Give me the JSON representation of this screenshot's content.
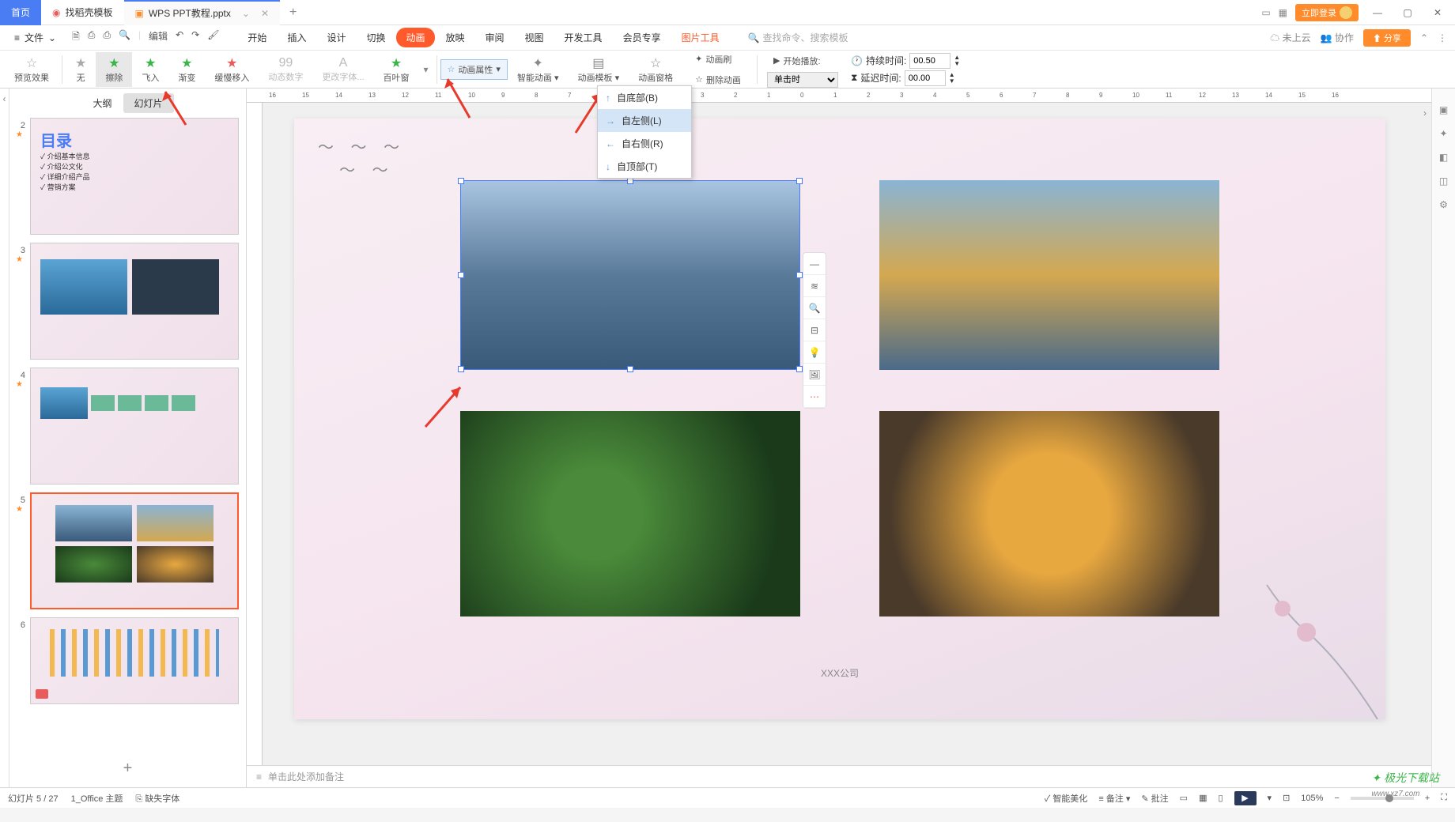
{
  "tabs": {
    "home": "首页",
    "template": "找稻壳模板",
    "file": "WPS PPT教程.pptx"
  },
  "titlebar": {
    "login": "立即登录"
  },
  "file_menu": "文件",
  "edit_label": "编辑",
  "main_tabs": [
    "开始",
    "插入",
    "设计",
    "切换",
    "动画",
    "放映",
    "审阅",
    "视图",
    "开发工具",
    "会员专享",
    "图片工具"
  ],
  "search_placeholder": "查找命令、搜索模板",
  "cloud": "未上云",
  "collab": "协作",
  "share": "分享",
  "ribbon": {
    "preview": "预览效果",
    "none": "无",
    "wipe": "擦除",
    "flyin": "飞入",
    "fade": "渐变",
    "slow": "缓慢移入",
    "dynnum": "动态数字",
    "changefont": "更改字体...",
    "blinds": "百叶窗",
    "animprop": "动画属性",
    "smart": "智能动画",
    "animtpl": "动画模板",
    "animpane": "动画窗格",
    "brush": "动画刷",
    "delanim": "删除动画",
    "startplay": "开始播放:",
    "duration": "持续时间:",
    "delay": "延迟时间:",
    "trigger": "单击时",
    "dur_val": "00.50",
    "delay_val": "00.00"
  },
  "dropdown": {
    "bottom": "自底部(B)",
    "left": "自左侧(L)",
    "right": "自右侧(R)",
    "top": "自顶部(T)"
  },
  "panel": {
    "outline": "大纲",
    "slides": "幻灯片"
  },
  "thumbs": {
    "t2_title": "目录",
    "t2_items": [
      "✓ 介绍基本信息",
      "✓ 介绍公文化",
      "✓ 详细介绍产品",
      "✓ 营销方案"
    ]
  },
  "company": "XXX公司",
  "notes": "单击此处添加备注",
  "status": {
    "slide": "幻灯片 5 / 27",
    "theme": "1_Office 主题",
    "missingfont": "缺失字体",
    "smart": "智能美化",
    "notes": "备注",
    "批注": "批注",
    "zoom": "105%"
  },
  "watermark": "极光下载站"
}
